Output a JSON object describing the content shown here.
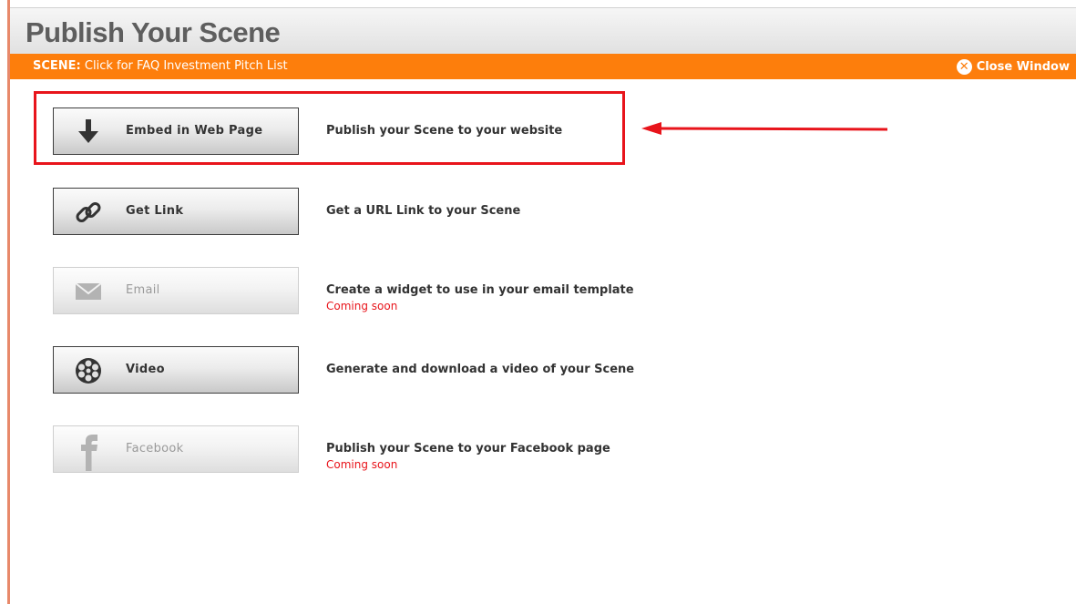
{
  "header": {
    "title": "Publish Your Scene"
  },
  "scene_bar": {
    "prefix": "SCENE:",
    "text": "Click for FAQ Investment Pitch List",
    "close_label": "Close Window",
    "close_glyph": "✕"
  },
  "actions": [
    {
      "label": "Embed in Web Page",
      "description": "Publish your Scene to your website",
      "note": "",
      "icon": "download-arrow-icon",
      "enabled": true
    },
    {
      "label": "Get Link",
      "description": "Get a URL Link to your Scene",
      "note": "",
      "icon": "chain-link-icon",
      "enabled": true
    },
    {
      "label": "Email",
      "description": "Create a widget to use in your email template",
      "note": "Coming soon",
      "icon": "envelope-icon",
      "enabled": false
    },
    {
      "label": "Video",
      "description": "Generate and download a video of your Scene",
      "note": "",
      "icon": "film-reel-icon",
      "enabled": true
    },
    {
      "label": "Facebook",
      "description": "Publish your Scene to your Facebook page",
      "note": "Coming soon",
      "icon": "facebook-icon",
      "enabled": false
    }
  ],
  "colors": {
    "accent_orange": "#fd7e0c",
    "annotation_red": "#e8141b",
    "coming_soon": "#e8141b"
  }
}
